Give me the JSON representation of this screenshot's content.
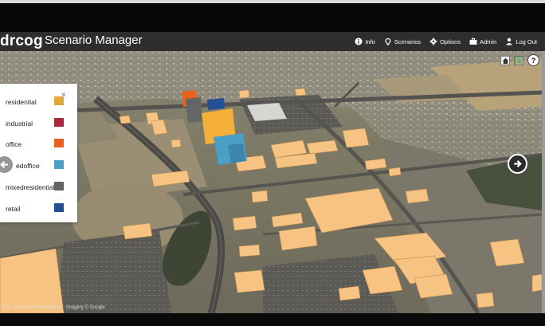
{
  "header": {
    "logo": "drcog",
    "title": "Scenario Manager"
  },
  "nav": [
    {
      "label": "Info",
      "icon": "info-icon"
    },
    {
      "label": "Scenarios",
      "icon": "map-pin-icon"
    },
    {
      "label": "Options",
      "icon": "gear-icon"
    },
    {
      "label": "Admin",
      "icon": "briefcase-icon"
    },
    {
      "label": "Log Out",
      "icon": "user-icon"
    }
  ],
  "map_controls": {
    "home_icon": "home-icon",
    "layers_icon": "map-layers-icon",
    "help_label": "?"
  },
  "legend": {
    "close_label": "×",
    "items": [
      {
        "label": "residential",
        "color": "#e3a93d"
      },
      {
        "label": "industrial",
        "color": "#a8283b"
      },
      {
        "label": "office",
        "color": "#e8621e"
      },
      {
        "label": "edoffice",
        "color": "#4b9ec6"
      },
      {
        "label": "mixedresidential",
        "color": "#646464"
      },
      {
        "label": "retail",
        "color": "#234f93"
      }
    ]
  },
  "attribution": "Esri, Earthstar Geographics · Imagery © Google",
  "colors": {
    "building": "#f7c383",
    "office": "#e8621e",
    "blue_block": "#4b9ec6",
    "orange_block": "#f5b03a"
  }
}
